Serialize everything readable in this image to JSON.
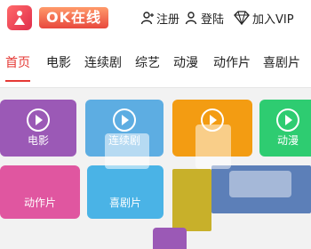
{
  "header": {
    "logo_text": "OK在线",
    "register_label": "注册",
    "login_label": "登陆",
    "vip_label": "加入VIP"
  },
  "nav": {
    "tabs": [
      {
        "label": "首页",
        "active": true
      },
      {
        "label": "电影",
        "active": false
      },
      {
        "label": "连续剧",
        "active": false
      },
      {
        "label": "综艺",
        "active": false
      },
      {
        "label": "动漫",
        "active": false
      },
      {
        "label": "动作片",
        "active": false
      },
      {
        "label": "喜剧片",
        "active": false
      }
    ]
  },
  "tiles": [
    {
      "label": "电影",
      "color": "#9b59b6"
    },
    {
      "label": "连续剧",
      "color": "#5dade2"
    },
    {
      "label": "",
      "color": "#f39c12"
    },
    {
      "label": "动漫",
      "color": "#2ecc71"
    },
    {
      "label": "动作片",
      "color": "#e056a0"
    },
    {
      "label": "喜剧片",
      "color": "#4ab3e6"
    },
    {
      "label": "",
      "color": "#c8b02a"
    },
    {
      "label": "",
      "color": "#5c7fb8"
    }
  ],
  "colors": {
    "accent": "#e53935"
  }
}
